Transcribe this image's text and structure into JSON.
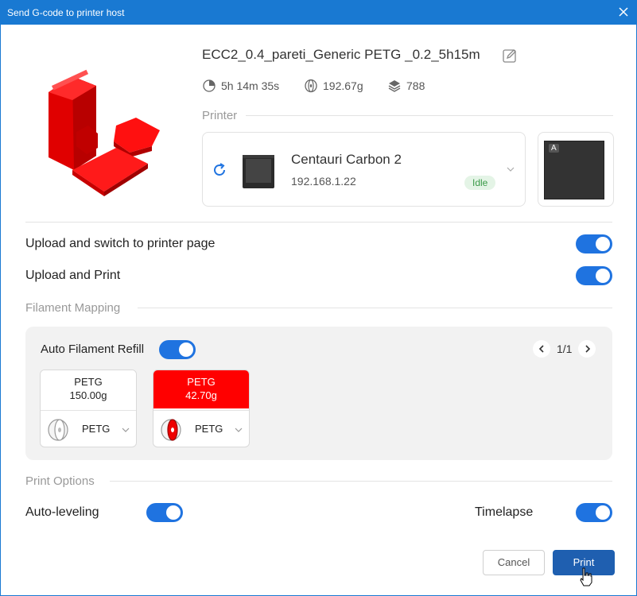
{
  "window": {
    "title": "Send G-code to printer host"
  },
  "file": {
    "name": "ECC2_0.4_pareti_Generic PETG _0.2_5h15m"
  },
  "stats": {
    "time": "5h 14m 35s",
    "weight": "192.67g",
    "layers": "788"
  },
  "printer": {
    "section_label": "Printer",
    "name": "Centauri Carbon 2",
    "ip": "192.168.1.22",
    "status": "Idle",
    "thumb_badge": "A"
  },
  "options": {
    "upload_switch_label": "Upload and switch to printer page",
    "upload_switch_on": true,
    "upload_print_label": "Upload and Print",
    "upload_print_on": true
  },
  "filament_mapping": {
    "section_label": "Filament Mapping",
    "auto_refill_label": "Auto Filament Refill",
    "auto_refill_on": true,
    "page": "1/1",
    "slots": [
      {
        "type": "PETG",
        "weight": "150.00g",
        "color": "#ffffff",
        "text_color": "#222222",
        "assigned": "PETG"
      },
      {
        "type": "PETG",
        "weight": "42.70g",
        "color": "#ff0000",
        "text_color": "#ffffff",
        "assigned": "PETG"
      }
    ]
  },
  "print_options": {
    "section_label": "Print Options",
    "auto_leveling_label": "Auto-leveling",
    "auto_leveling_on": true,
    "timelapse_label": "Timelapse",
    "timelapse_on": true
  },
  "buttons": {
    "cancel": "Cancel",
    "print": "Print"
  },
  "colors": {
    "accent": "#1f73e0",
    "titlebar": "#1979d2",
    "filament_red": "#ff0000"
  }
}
